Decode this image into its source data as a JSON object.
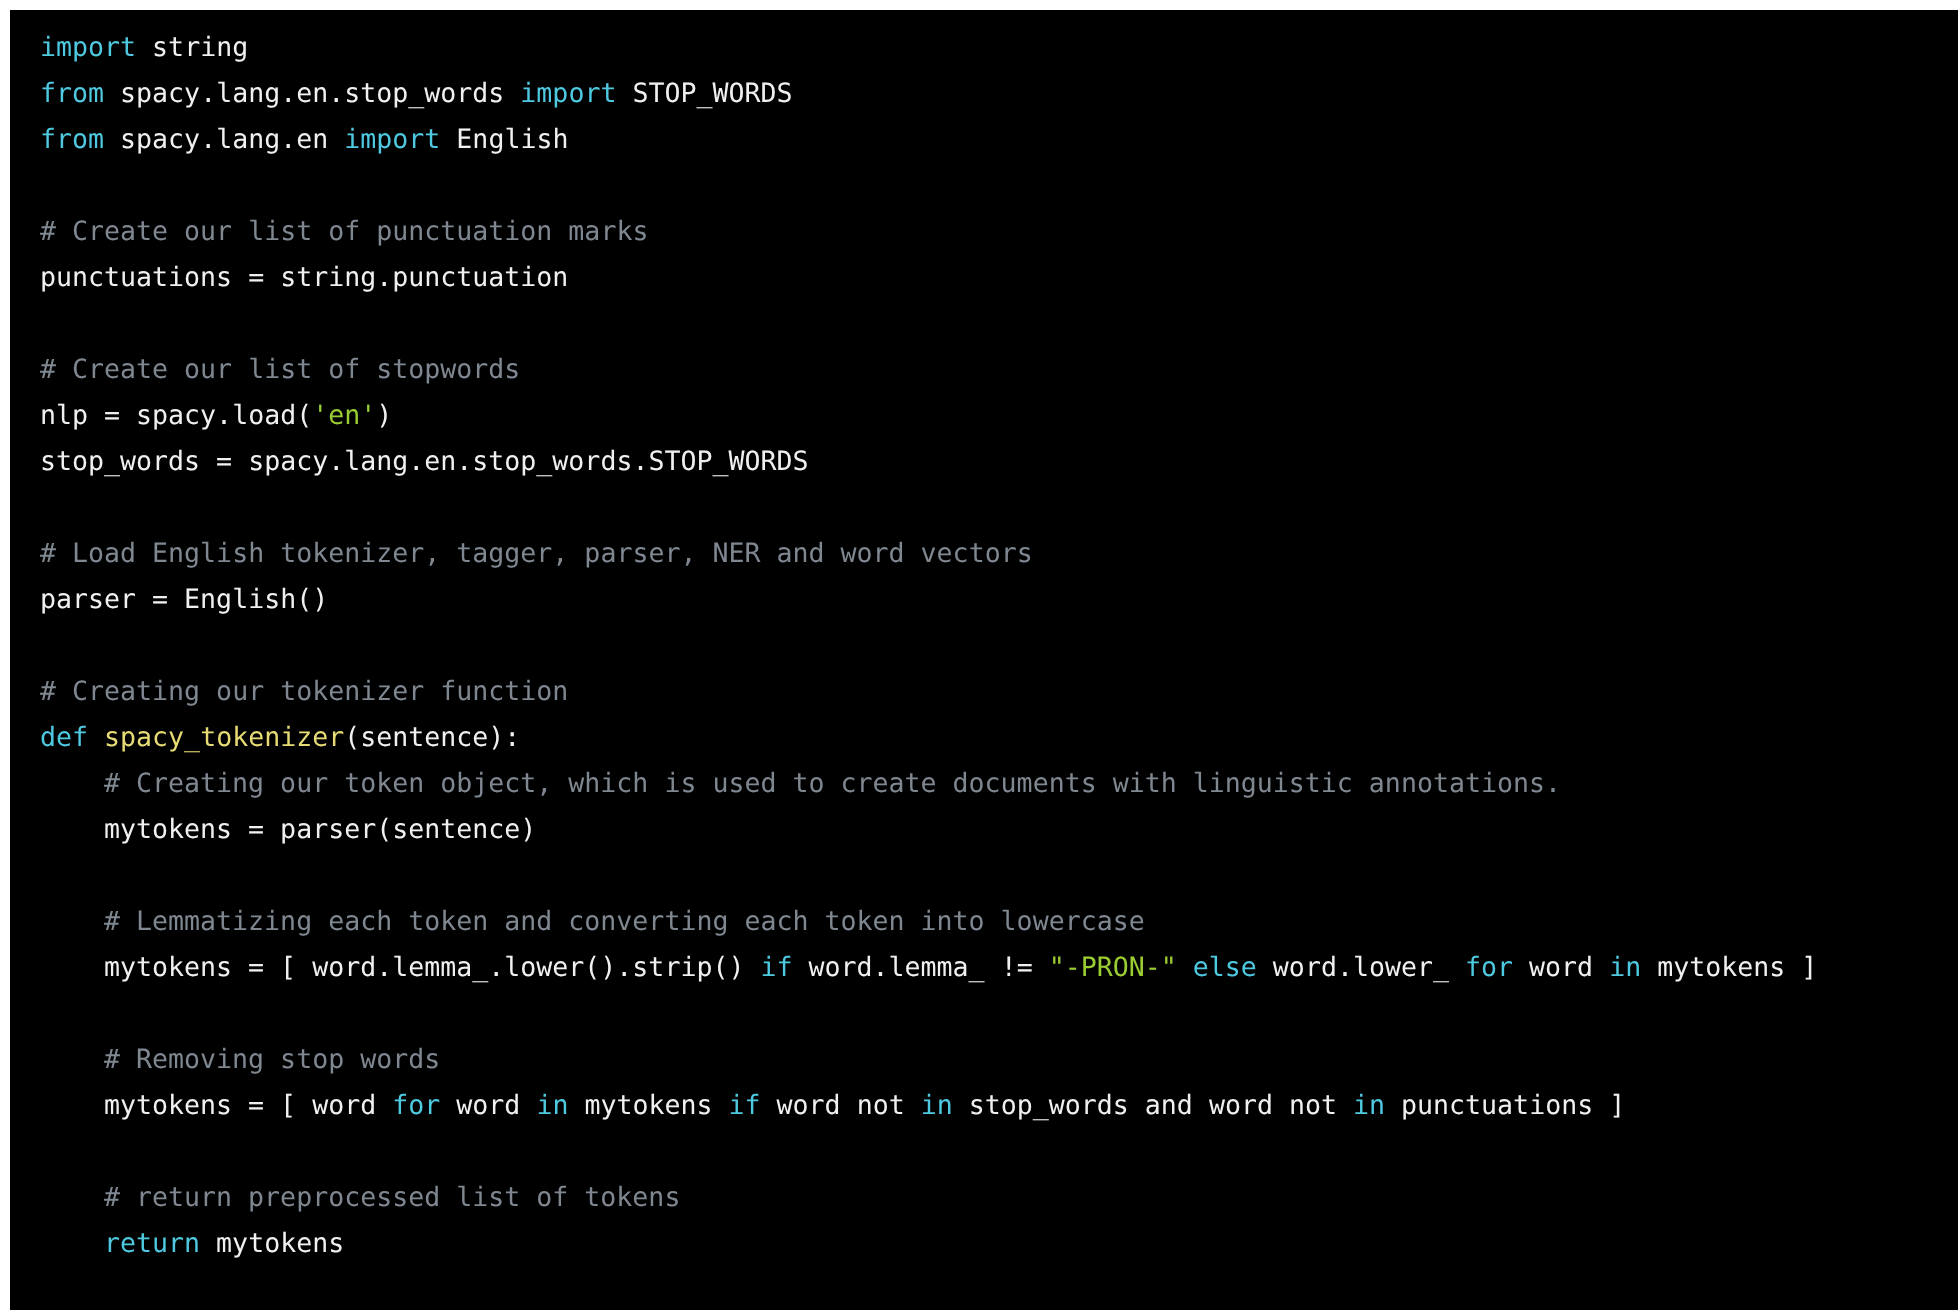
{
  "code_block": {
    "lines": [
      {
        "kind": "code",
        "tokens": [
          {
            "kind": "keyword",
            "text": "import"
          },
          {
            "kind": "plain",
            "text": " string"
          }
        ]
      },
      {
        "kind": "code",
        "tokens": [
          {
            "kind": "keyword",
            "text": "from"
          },
          {
            "kind": "plain",
            "text": " spacy.lang.en.stop_words "
          },
          {
            "kind": "keyword",
            "text": "import"
          },
          {
            "kind": "plain",
            "text": " STOP_WORDS"
          }
        ]
      },
      {
        "kind": "code",
        "tokens": [
          {
            "kind": "keyword",
            "text": "from"
          },
          {
            "kind": "plain",
            "text": " spacy.lang.en "
          },
          {
            "kind": "keyword",
            "text": "import"
          },
          {
            "kind": "plain",
            "text": " English"
          }
        ]
      },
      {
        "kind": "blank"
      },
      {
        "kind": "code",
        "tokens": [
          {
            "kind": "comment",
            "text": "# Create our list of punctuation marks"
          }
        ]
      },
      {
        "kind": "code",
        "tokens": [
          {
            "kind": "plain",
            "text": "punctuations = string.punctuation"
          }
        ]
      },
      {
        "kind": "blank"
      },
      {
        "kind": "code",
        "tokens": [
          {
            "kind": "comment",
            "text": "# Create our list of stopwords"
          }
        ]
      },
      {
        "kind": "code",
        "tokens": [
          {
            "kind": "plain",
            "text": "nlp = spacy.load("
          },
          {
            "kind": "string",
            "text": "'en'"
          },
          {
            "kind": "plain",
            "text": ")"
          }
        ]
      },
      {
        "kind": "code",
        "tokens": [
          {
            "kind": "plain",
            "text": "stop_words = spacy.lang.en.stop_words.STOP_WORDS"
          }
        ]
      },
      {
        "kind": "blank"
      },
      {
        "kind": "code",
        "tokens": [
          {
            "kind": "comment",
            "text": "# Load English tokenizer, tagger, parser, NER and word vectors"
          }
        ]
      },
      {
        "kind": "code",
        "tokens": [
          {
            "kind": "plain",
            "text": "parser = English()"
          }
        ]
      },
      {
        "kind": "blank"
      },
      {
        "kind": "code",
        "tokens": [
          {
            "kind": "comment",
            "text": "# Creating our tokenizer function"
          }
        ]
      },
      {
        "kind": "code",
        "tokens": [
          {
            "kind": "keyword",
            "text": "def "
          },
          {
            "kind": "function",
            "text": "spacy_tokenizer"
          },
          {
            "kind": "plain",
            "text": "(sentence):"
          }
        ],
        "children": [
          {
            "kind": "code",
            "tokens": [
              {
                "kind": "comment",
                "text": "# Creating our token object, which is used to create documents with linguistic annotations."
              }
            ]
          },
          {
            "kind": "code",
            "tokens": [
              {
                "kind": "plain",
                "text": "mytokens = parser(sentence)"
              }
            ]
          },
          {
            "kind": "blank"
          },
          {
            "kind": "code",
            "tokens": [
              {
                "kind": "comment",
                "text": "# Lemmatizing each token and converting each token into lowercase"
              }
            ]
          },
          {
            "kind": "code",
            "tokens": [
              {
                "kind": "plain",
                "text": "mytokens = [ word.lemma_.lower().strip() "
              },
              {
                "kind": "keyword",
                "text": "if"
              },
              {
                "kind": "plain",
                "text": " word.lemma_ != "
              },
              {
                "kind": "string",
                "text": "\"-PRON-\""
              },
              {
                "kind": "keyword",
                "text": " else"
              },
              {
                "kind": "plain",
                "text": " word.lower_ "
              },
              {
                "kind": "keyword",
                "text": "for"
              },
              {
                "kind": "plain",
                "text": " word "
              },
              {
                "kind": "keyword",
                "text": "in"
              },
              {
                "kind": "plain",
                "text": " mytokens ]"
              }
            ]
          },
          {
            "kind": "blank"
          },
          {
            "kind": "code",
            "tokens": [
              {
                "kind": "comment",
                "text": "# Removing stop words"
              }
            ]
          },
          {
            "kind": "code",
            "tokens": [
              {
                "kind": "plain",
                "text": "mytokens = [ word "
              },
              {
                "kind": "keyword",
                "text": "for"
              },
              {
                "kind": "plain",
                "text": " word "
              },
              {
                "kind": "keyword",
                "text": "in"
              },
              {
                "kind": "plain",
                "text": " mytokens "
              },
              {
                "kind": "keyword",
                "text": "if"
              },
              {
                "kind": "plain",
                "text": " word not "
              },
              {
                "kind": "keyword",
                "text": "in"
              },
              {
                "kind": "plain",
                "text": " stop_words and word not "
              },
              {
                "kind": "keyword",
                "text": "in"
              },
              {
                "kind": "plain",
                "text": " punctuations ]"
              }
            ]
          },
          {
            "kind": "blank"
          },
          {
            "kind": "code",
            "tokens": [
              {
                "kind": "comment",
                "text": "# return preprocessed list of tokens"
              }
            ]
          },
          {
            "kind": "code",
            "tokens": [
              {
                "kind": "keyword",
                "text": "return"
              },
              {
                "kind": "plain",
                "text": " mytokens"
              }
            ]
          }
        ]
      }
    ]
  }
}
